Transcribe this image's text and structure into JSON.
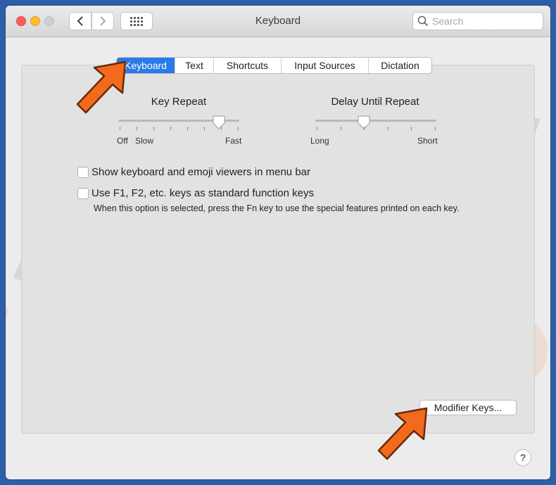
{
  "window": {
    "title": "Keyboard",
    "search_placeholder": "Search"
  },
  "tabs": [
    {
      "label": "Keyboard",
      "active": true
    },
    {
      "label": "Text",
      "active": false
    },
    {
      "label": "Shortcuts",
      "active": false
    },
    {
      "label": "Input Sources",
      "active": false
    },
    {
      "label": "Dictation",
      "active": false
    }
  ],
  "key_repeat": {
    "label": "Key Repeat",
    "min_label": "Off",
    "slow_label": "Slow",
    "max_label": "Fast",
    "value_fraction": 0.83
  },
  "delay_until_repeat": {
    "label": "Delay Until Repeat",
    "min_label": "Long",
    "max_label": "Short",
    "value_fraction": 0.4
  },
  "options": {
    "show_viewers_label": "Show keyboard and emoji viewers in menu bar",
    "show_viewers_checked": false,
    "fn_keys_label": "Use F1, F2, etc. keys as standard function keys",
    "fn_keys_checked": false,
    "fn_keys_note": "When this option is selected, press the Fn key to use the special features printed on each key."
  },
  "buttons": {
    "modifier_keys": "Modifier Keys...",
    "help": "?"
  },
  "watermark": {
    "text": "PC risk.com"
  },
  "colors": {
    "accent": "#2a7ae8",
    "arrow": "#f26a1b",
    "background": "#2d5fa8"
  }
}
